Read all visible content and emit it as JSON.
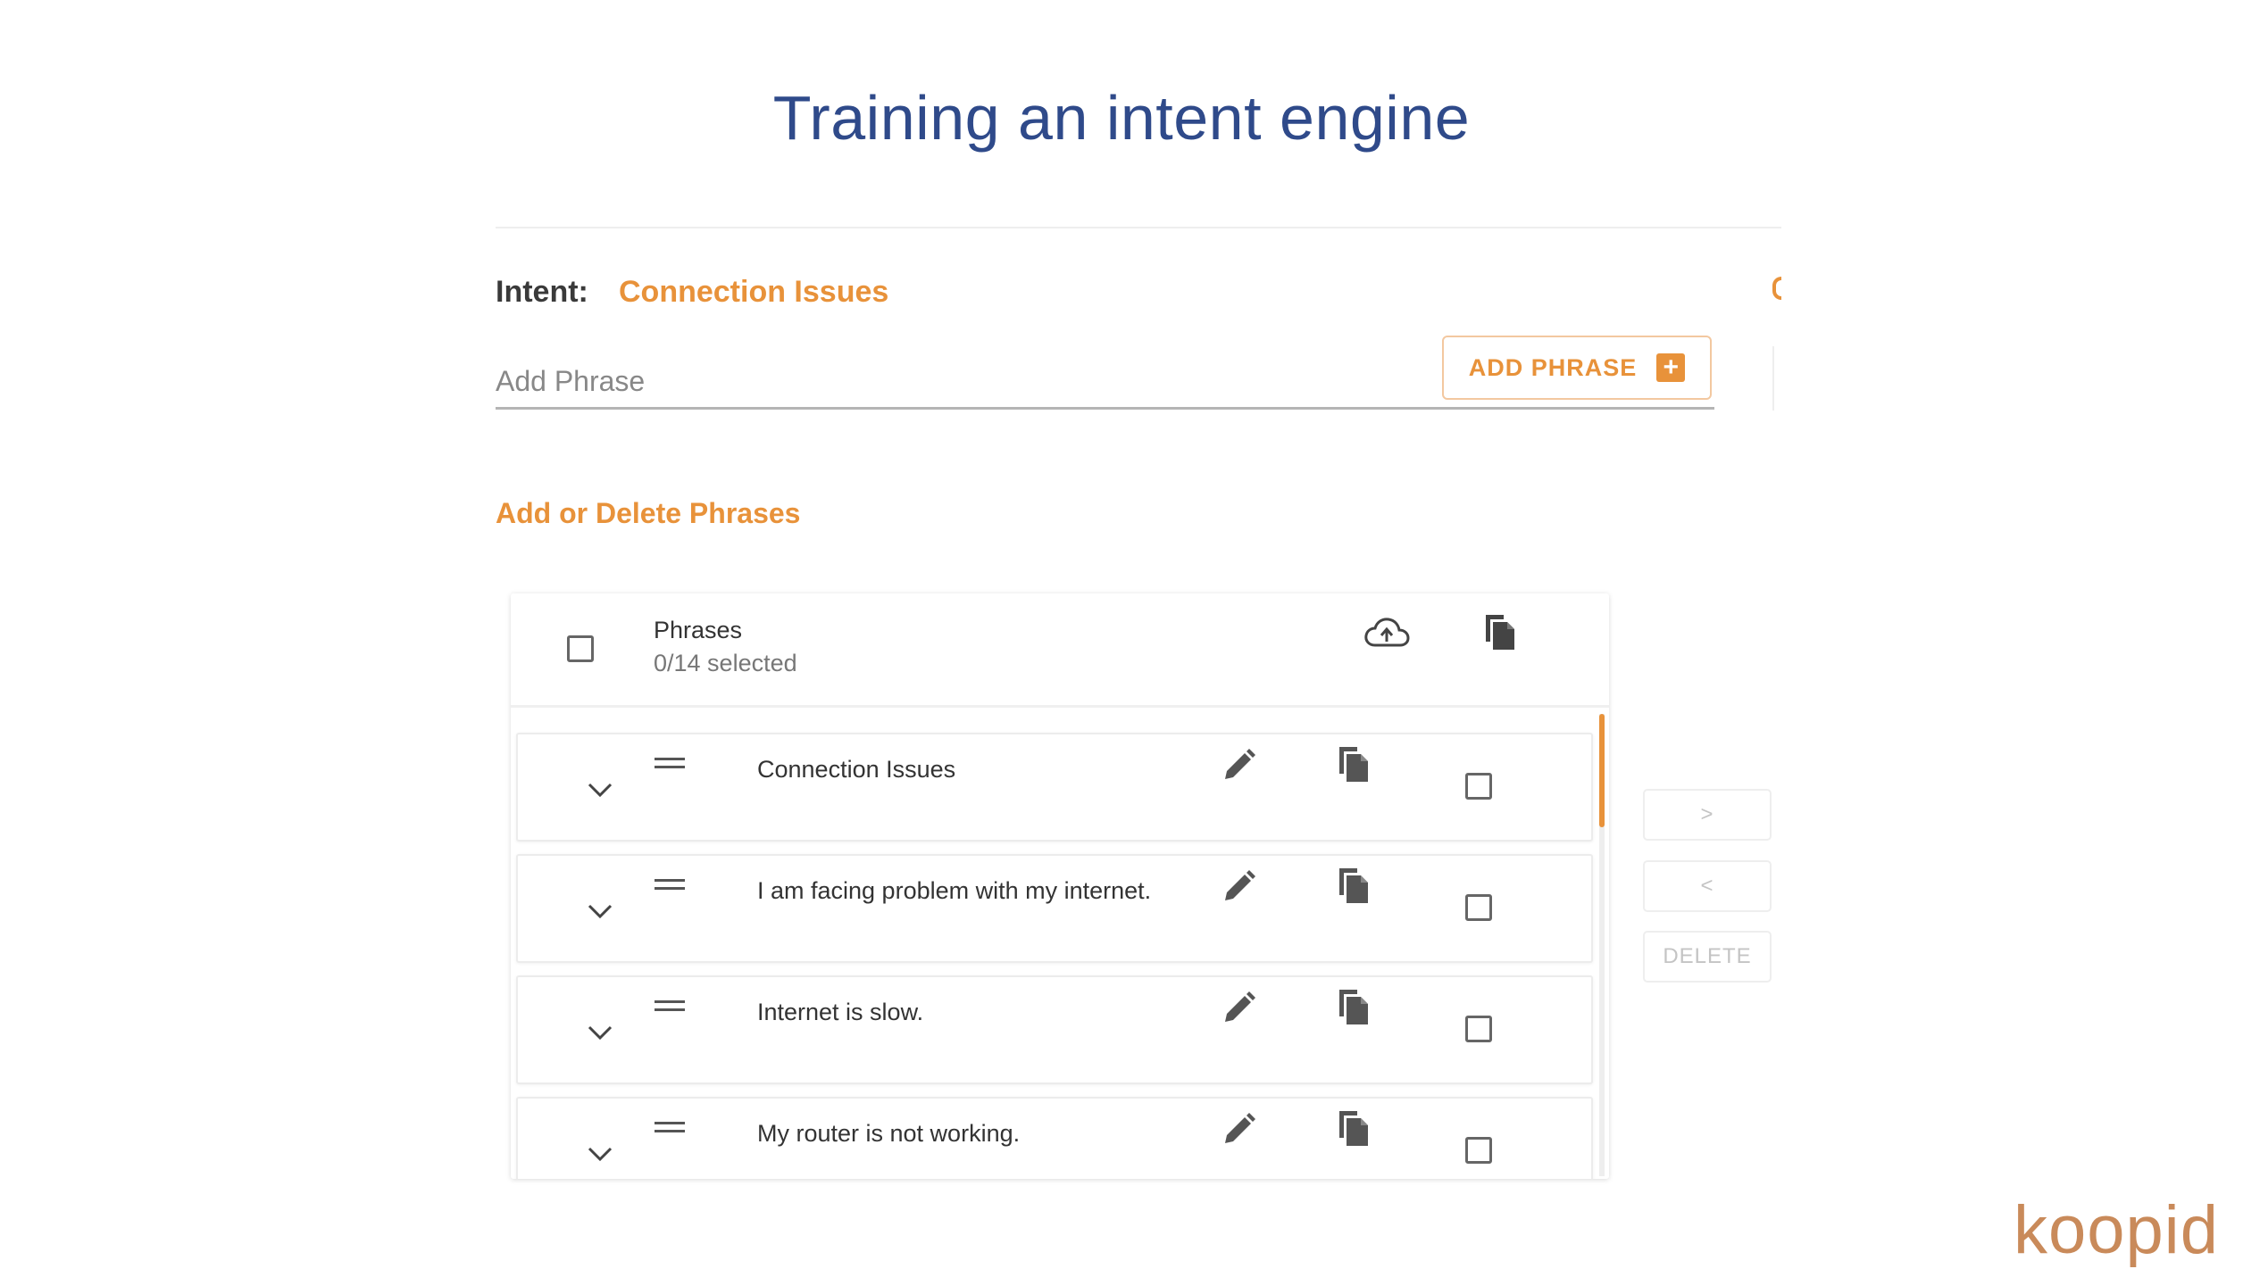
{
  "page": {
    "title": "Training an intent engine"
  },
  "intent": {
    "label": "Intent:",
    "value": "Connection Issues"
  },
  "add_phrase": {
    "placeholder": "Add Phrase",
    "value": "",
    "button_label": "ADD PHRASE",
    "button_icon": "plus-box-icon"
  },
  "section_title": "Add or Delete Phrases",
  "table": {
    "header_title": "Phrases",
    "selection_status": "0/14 selected",
    "header_icons": [
      "cloud-upload-icon",
      "copy-icon"
    ],
    "rows": [
      {
        "text": "Connection Issues"
      },
      {
        "text": "I am facing problem with my internet."
      },
      {
        "text": "Internet is slow."
      },
      {
        "text": "My router is not working."
      }
    ],
    "row_icons": [
      "chevron-down-icon",
      "drag-handle-icon",
      "pencil-icon",
      "copy-icon"
    ]
  },
  "side_buttons": {
    "move_right": ">",
    "move_left": "<",
    "delete": "DELETE"
  },
  "logo": "koopid",
  "colors": {
    "accent": "#e8923a",
    "title": "#2f4a8a",
    "logo": "#c98a5a"
  }
}
